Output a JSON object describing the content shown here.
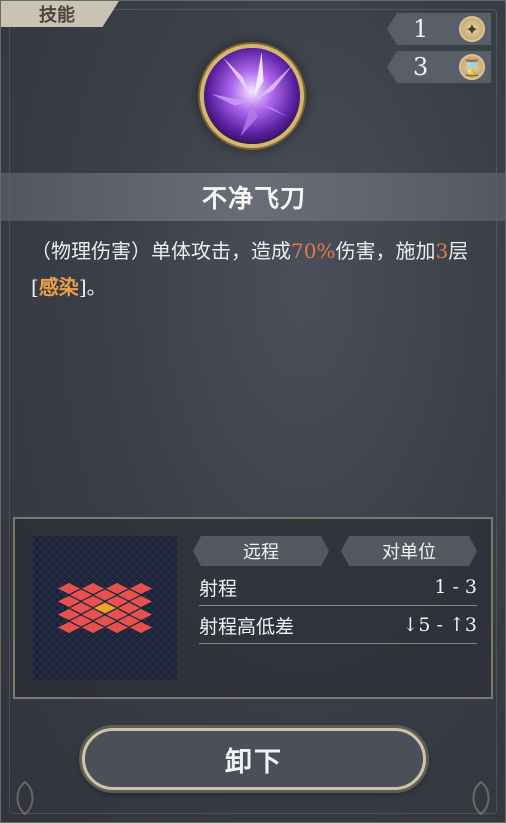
{
  "tab_label": "技能",
  "counters": [
    {
      "value": "1",
      "icon": "sparkle-icon",
      "glyph": "✦"
    },
    {
      "value": "3",
      "icon": "hourglass-icon",
      "glyph": "⌛"
    }
  ],
  "skill": {
    "name": "不净飞刀",
    "icon": "purple-blades-icon",
    "desc_part1": "（物理伤害）单体攻击，造成",
    "desc_damage": "70%",
    "desc_part2": "伤害，施加",
    "desc_stacks": "3",
    "desc_part3": "层[",
    "desc_status": "感染",
    "desc_part4": "]。"
  },
  "info": {
    "type_label": "远程",
    "target_label": "对单位",
    "range_label": "射程",
    "range_value": "1 - 3",
    "height_label": "射程高低差",
    "height_down": "5",
    "height_up": "3"
  },
  "action_button": "卸下",
  "colors": {
    "highlight_orange": "#e07a4a",
    "status_gold": "#e7a04a",
    "grid_red": "#e8524e",
    "grid_center": "#f0a020"
  }
}
